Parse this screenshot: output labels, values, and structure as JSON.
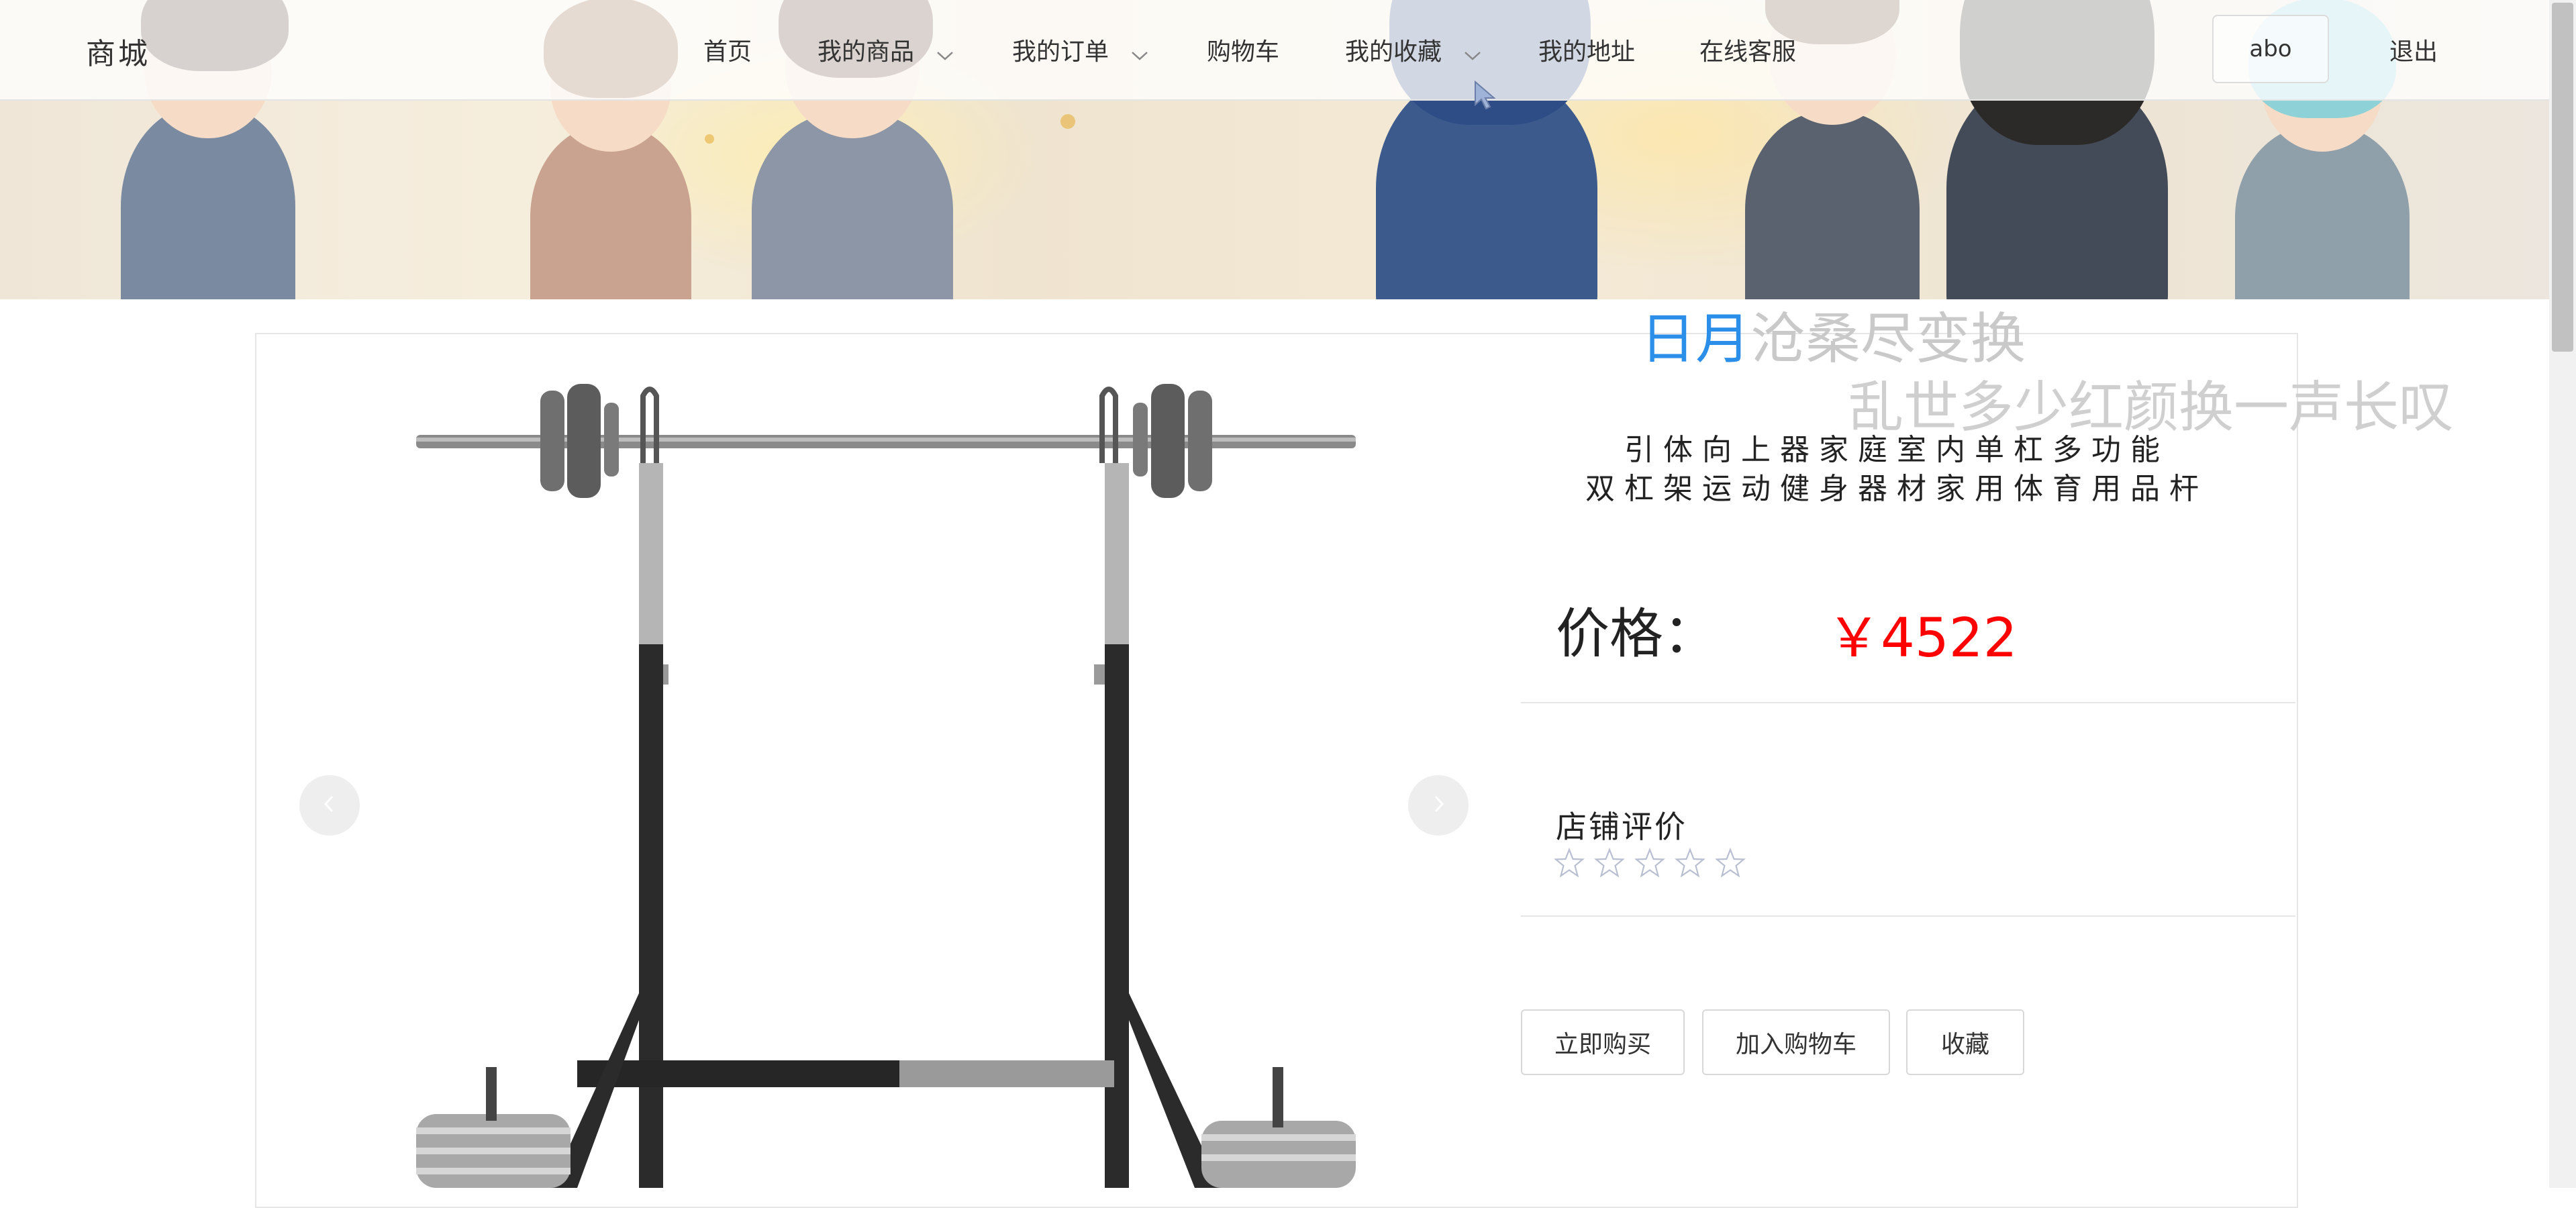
{
  "nav": {
    "brand": "商城",
    "items": [
      {
        "label": "首页",
        "dropdown": false
      },
      {
        "label": "我的商品",
        "dropdown": true
      },
      {
        "label": "我的订单",
        "dropdown": true
      },
      {
        "label": "购物车",
        "dropdown": false
      },
      {
        "label": "我的收藏",
        "dropdown": true
      },
      {
        "label": "我的地址",
        "dropdown": false
      },
      {
        "label": "在线客服",
        "dropdown": false
      }
    ],
    "user": "abo",
    "logout": "退出"
  },
  "poem": {
    "line1_highlight": "日月",
    "line1_rest": "沧桑尽变换",
    "line2": "乱世多少红颜换一声长叹"
  },
  "product": {
    "title_line1": "引体向上器家庭室内单杠多功能",
    "title_line2": "双杠架运动健身器材家用体育用品杆",
    "price_label": "价格：",
    "price": "￥4522",
    "reviews_label": "店铺评价",
    "rating": 0,
    "rating_max": 5
  },
  "actions": {
    "buy_now": "立即购买",
    "add_to_cart": "加入购物车",
    "favorite": "收藏"
  },
  "colors": {
    "price": "#ff0000",
    "poem_highlight": "#2b8ee8",
    "star_outline": "#b8bfd0"
  }
}
